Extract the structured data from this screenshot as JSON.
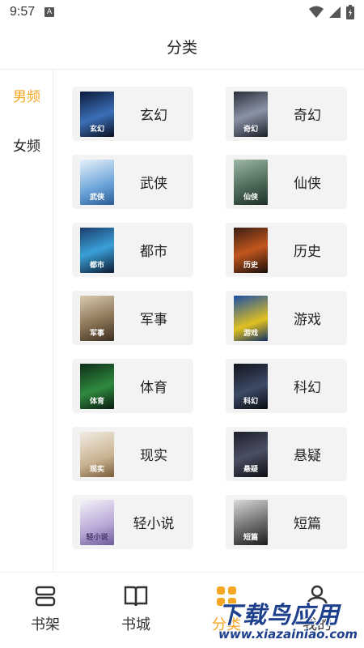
{
  "status_bar": {
    "time": "9:57",
    "notif_icon": "A",
    "icons": [
      "wifi-icon",
      "signal-icon",
      "battery-icon"
    ]
  },
  "header": {
    "title": "分类"
  },
  "sidebar": {
    "items": [
      {
        "label": "男频",
        "active": true
      },
      {
        "label": "女频",
        "active": false
      }
    ]
  },
  "categories": [
    {
      "label": "玄幻"
    },
    {
      "label": "奇幻"
    },
    {
      "label": "武侠"
    },
    {
      "label": "仙侠"
    },
    {
      "label": "都市"
    },
    {
      "label": "历史"
    },
    {
      "label": "军事"
    },
    {
      "label": "游戏"
    },
    {
      "label": "体育"
    },
    {
      "label": "科幻"
    },
    {
      "label": "现实"
    },
    {
      "label": "悬疑"
    },
    {
      "label": "轻小说"
    },
    {
      "label": "短篇"
    }
  ],
  "bottom_nav": {
    "items": [
      {
        "label": "书架",
        "icon": "bookshelf-icon",
        "active": false
      },
      {
        "label": "书城",
        "icon": "book-open-icon",
        "active": false
      },
      {
        "label": "分类",
        "icon": "category-icon",
        "active": true
      },
      {
        "label": "我的",
        "icon": "user-icon",
        "active": false
      }
    ]
  },
  "watermark": {
    "main": "下载鸟应用",
    "url": "www.xiazainiao.com"
  },
  "colors": {
    "accent": "#f5a623",
    "card_bg": "#f3f3f3",
    "text": "#222222"
  }
}
